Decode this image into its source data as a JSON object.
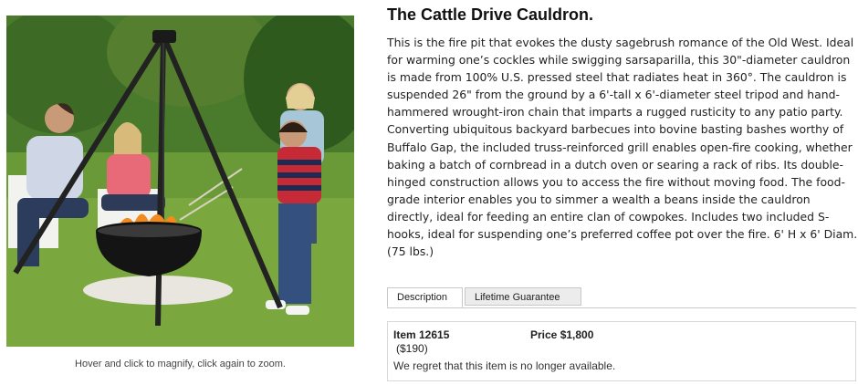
{
  "product": {
    "title": "The Cattle Drive Cauldron.",
    "description": "This is the fire pit that evokes the dusty sagebrush romance of the Old West. Ideal for warming one’s cockles while swigging sarsaparilla, this 30\"-diameter cauldron is made from 100% U.S. pressed steel that radiates heat in 360°. The cauldron is suspended 26\" from the ground by a 6'-tall x 6'-diameter steel tripod and hand-hammered wrought-iron chain that imparts a rugged rusticity to any patio party. Converting ubiquitous backyard barbecues into bovine basting bashes worthy of Buffalo Gap, the included truss-reinforced grill enables open-fire cooking, whether baking a batch of cornbread in a dutch oven or searing a rack of ribs. Its double-hinged construction allows you to access the fire without moving food. The food-grade interior enables you to simmer a wealth a beans inside the cauldron directly, ideal for feeding an entire clan of cowpokes. Includes two included S-hooks, ideal for suspending one’s preferred coffee pot over the fire. 6' H x 6' Diam. (75 lbs.)"
  },
  "image": {
    "caption": "Hover and click to magnify, click again to zoom."
  },
  "tabs": [
    {
      "label": "Description",
      "active": true
    },
    {
      "label": "Lifetime Guarantee",
      "active": false
    }
  ],
  "purchase": {
    "item_label": "Item 12615",
    "price_label": "Price $1,800",
    "shipping": "($190)",
    "availability": "We regret that this item is no longer available."
  }
}
